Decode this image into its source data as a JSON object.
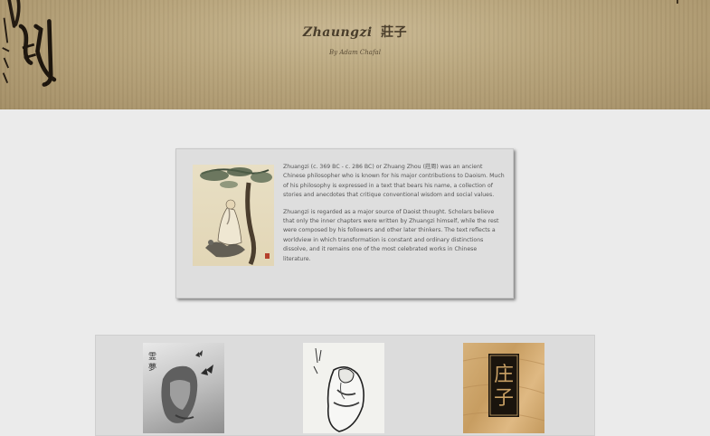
{
  "header": {
    "title": "Zhaungzi",
    "title_cn": "莊子",
    "byline": "By Adam Chafal"
  },
  "intro": {
    "image_icon": "sage-under-pine-painting",
    "paragraphs": [
      "Zhuangzi (c. 369 BC - c. 286 BC) or Zhuang Zhou (莊周) was an ancient Chinese philosopher who is known for his major contributions to Daoism. Much of his philosophy is expressed in a text that bears his name, a collection of stories and anecdotes that critique conventional wisdom and social values.",
      "Zhuangzi is regarded as a major source of Daoist thought. Scholars believe that only the inner chapters were written by Zhuangzi himself, while the rest were composed by his followers and other later thinkers. The text reflects a worldview in which transformation is constant and ordinary distinctions dissolve, and it remains one of the most celebrated works in Chinese literature."
    ]
  },
  "gallery": {
    "items": [
      {
        "name": "portrait-with-butterfly"
      },
      {
        "name": "ink-sage-figure"
      },
      {
        "name": "zhuangzi-woodblock-characters",
        "text": "庄子"
      }
    ]
  },
  "colors": {
    "page_bg": "#ebebeb",
    "banner": "#b8a47b",
    "card_bg": "#dedede",
    "text": "#555555"
  }
}
